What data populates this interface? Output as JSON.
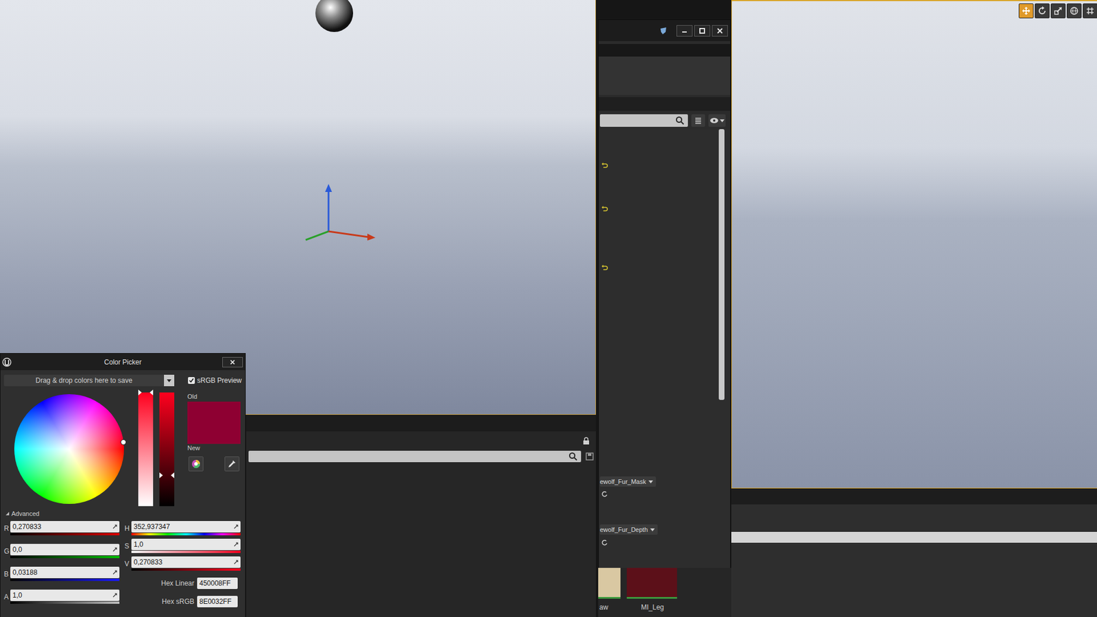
{
  "right_viewport": {
    "toolbar": [
      {
        "kind": "move",
        "selected": true
      },
      {
        "kind": "rotate",
        "selected": false
      },
      {
        "kind": "scale",
        "selected": false
      },
      {
        "kind": "globe",
        "selected": false
      },
      {
        "kind": "grid",
        "selected": false
      }
    ]
  },
  "color_picker": {
    "title": "Color Picker",
    "saved_colors": {
      "placeholder": "Drag & drop colors here to save"
    },
    "srgb_preview": {
      "label": "sRGB Preview",
      "checked": true
    },
    "wheel": {
      "hue_level": 0.9804,
      "saturation_level": 1
    },
    "sliders": [
      {
        "kind": "saturation",
        "level": 1
      },
      {
        "kind": "value",
        "level": 0.27
      }
    ],
    "swatch": {
      "old_label": "Old",
      "new_label": "New",
      "old_color": "#8E0032",
      "new_color": "#8E0032"
    },
    "advanced": {
      "label": "Advanced",
      "expanded": true
    },
    "rgba": [
      {
        "label": "R",
        "value": "0,270833",
        "color": "#e00000"
      },
      {
        "label": "G",
        "value": "0,0",
        "color": "#00c000"
      },
      {
        "label": "B",
        "value": "0,03188",
        "color": "#1a1aff"
      },
      {
        "label": "A",
        "value": "1,0",
        "color": "#bdbdbd"
      }
    ],
    "hsv": [
      {
        "label": "H",
        "value": "352,937347",
        "kind": "hue"
      },
      {
        "label": "S",
        "value": "1,0",
        "kind": "saturation"
      },
      {
        "label": "V",
        "value": "0,270833",
        "kind": "value"
      }
    ],
    "hex": [
      {
        "label": "Hex Linear",
        "value": "450008FF"
      },
      {
        "label": "Hex sRGB",
        "value": "8E0032FF"
      }
    ]
  },
  "details_window": {
    "rows": [
      {
        "kind": "reset",
        "label": ""
      },
      {
        "kind": "reset",
        "label": ""
      },
      {
        "kind": "reset",
        "label": ""
      },
      {
        "kind": "asset",
        "label": "ewolf_Fur_Mask"
      },
      {
        "kind": "default",
        "label": ""
      },
      {
        "kind": "asset",
        "label": "ewolf_Fur_Depth"
      },
      {
        "kind": "default",
        "label": ""
      }
    ]
  },
  "content_browser": {
    "items": [
      {
        "label": "aw",
        "color": "#d9c8a2"
      },
      {
        "label": "MI_Leg",
        "color": "#5c1019"
      }
    ]
  }
}
